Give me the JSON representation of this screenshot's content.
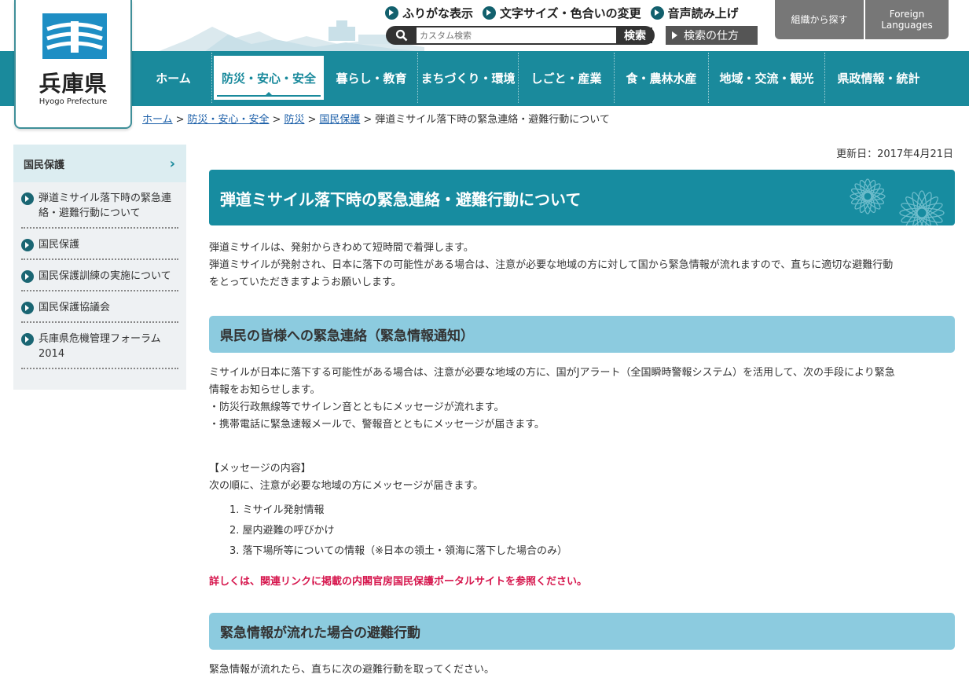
{
  "site": {
    "name": "兵庫県",
    "name_en": "Hyogo Prefecture"
  },
  "utility": {
    "furigana": "ふりがな表示",
    "text_size": "文字サイズ・色合いの変更",
    "voice": "音声読み上げ",
    "search_placeholder": "カスタム検索",
    "search_button": "検索",
    "search_howto": "検索の仕方",
    "org_search": "組織から探す",
    "foreign_1": "Foreign",
    "foreign_2": "Languages"
  },
  "nav": [
    {
      "label": "ホーム"
    },
    {
      "label": "防災・安心・安全"
    },
    {
      "label": "暮らし・教育"
    },
    {
      "label": "まちづくり・環境"
    },
    {
      "label": "しごと・産業"
    },
    {
      "label": "食・農林水産"
    },
    {
      "label": "地域・交流・観光"
    },
    {
      "label": "県政情報・統計"
    }
  ],
  "breadcrumb": {
    "items": [
      "ホーム",
      "防災・安心・安全",
      "防災",
      "国民保護"
    ],
    "current": "弾道ミサイル落下時の緊急連絡・避難行動について",
    "sep": ">"
  },
  "sidebar": {
    "heading": "国民保護",
    "items": [
      {
        "label": "弾道ミサイル落下時の緊急連絡・避難行動について"
      },
      {
        "label": "国民保護"
      },
      {
        "label": "国民保護訓練の実施について"
      },
      {
        "label": "国民保護協議会"
      },
      {
        "label": "兵庫県危機管理フォーラム2014"
      }
    ]
  },
  "main": {
    "updated": "更新日：2017年4月21日",
    "title": "弾道ミサイル落下時の緊急連絡・避難行動について",
    "intro_1": "弾道ミサイルは、発射からきわめて短時間で着弾します。",
    "intro_2": "弾道ミサイルが発射され、日本に落下の可能性がある場合は、注意が必要な地域の方に対して国から緊急情報が流れますので、直ちに適切な避難行動",
    "intro_3": "をとっていただきますようお願いします。",
    "h2_1": "県民の皆様への緊急連絡（緊急情報通知）",
    "s1_p1": "ミサイルが日本に落下する可能性がある場合は、注意が必要な地域の方に、国がJアラート（全国瞬時警報システム）を活用して、次の手段により緊急",
    "s1_p2": "情報をお知らせします。",
    "s1_p3": "・防災行政無線等でサイレン音とともにメッセージが流れます。",
    "s1_p4": "・携帯電話に緊急速報メールで、警報音とともにメッセージが届きます。",
    "msg_head": "【メッセージの内容】",
    "msg_lead": "次の順に、注意が必要な地域の方にメッセージが届きます。",
    "msg_list": [
      "1. ミサイル発射情報",
      "2. 屋内避難の呼びかけ",
      "3. 落下場所等についての情報（※日本の領土・領海に落下した場合のみ）"
    ],
    "note": "詳しくは、関連リンクに掲載の内閣官房国民保護ポータルサイトを参照ください。",
    "h2_2": "緊急情報が流れた場合の避難行動",
    "s2_p1": "緊急情報が流れたら、直ちに次の避難行動を取ってください。"
  },
  "colors": {
    "teal": "#1a8a9c",
    "light_blue": "#8ccbdf",
    "alert_red": "#d6164d"
  }
}
